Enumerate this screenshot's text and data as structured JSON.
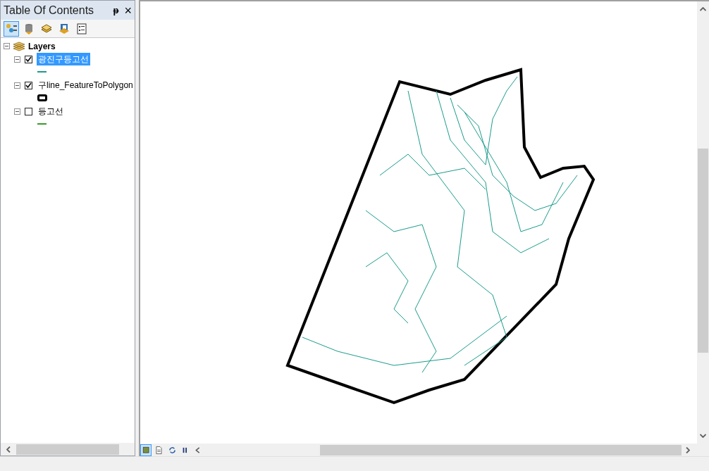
{
  "panel": {
    "title": "Table Of Contents",
    "pin": "ᵽ",
    "close": "×"
  },
  "toc_toolbar": [
    {
      "kind": "list-drawing-order",
      "selected": true
    },
    {
      "kind": "list-source",
      "selected": false
    },
    {
      "kind": "list-visibility",
      "selected": false
    },
    {
      "kind": "list-selection",
      "selected": false
    },
    {
      "kind": "options",
      "selected": false
    }
  ],
  "tree": {
    "label": "Layers",
    "expanded": true,
    "children": [
      {
        "label": "광진구등고선",
        "checked": true,
        "selected": true,
        "expanded": true,
        "symbol": {
          "kind": "line",
          "color": "#1a9c8c"
        }
      },
      {
        "label": "구line_FeatureToPolygon",
        "checked": true,
        "selected": false,
        "expanded": true,
        "symbol": {
          "kind": "polygon",
          "color": "#000000"
        }
      },
      {
        "label": "등고선",
        "checked": false,
        "selected": false,
        "expanded": true,
        "symbol": {
          "kind": "line",
          "color": "#3a9a2a"
        }
      }
    ]
  },
  "map_toolbar": [
    {
      "kind": "data-view",
      "selected": true
    },
    {
      "kind": "layout-view",
      "selected": false
    },
    {
      "kind": "refresh",
      "selected": false
    },
    {
      "kind": "pause",
      "selected": false
    },
    {
      "kind": "scroll-left",
      "selected": false
    }
  ]
}
